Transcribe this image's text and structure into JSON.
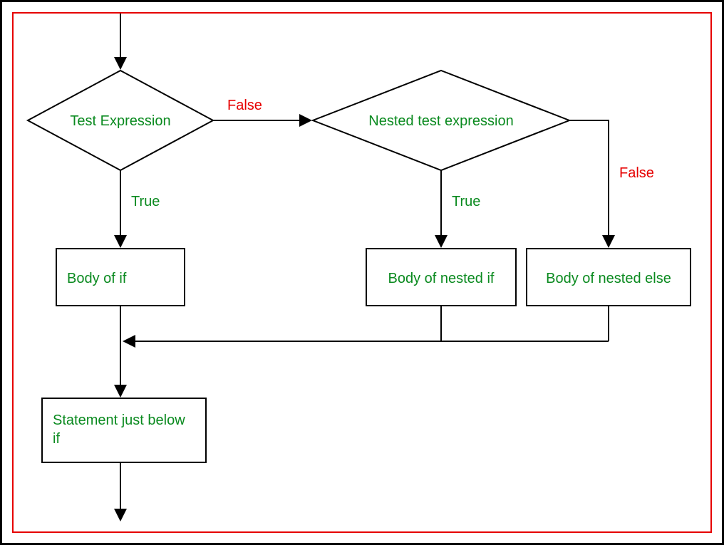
{
  "diagram": {
    "decisions": {
      "test_expression": "Test Expression",
      "nested_test_expression": "Nested test expression"
    },
    "processes": {
      "body_if": "Body of if",
      "body_nested_if": "Body of nested if",
      "body_nested_else": "Body of nested else",
      "statement_below": "Statement just below if"
    },
    "edges": {
      "true": "True",
      "false": "False"
    }
  },
  "colors": {
    "node_text": "#0a8a1f",
    "true_text": "#0a8a1f",
    "false_text": "#e60000",
    "border": "#000",
    "frame": "#e60000"
  }
}
